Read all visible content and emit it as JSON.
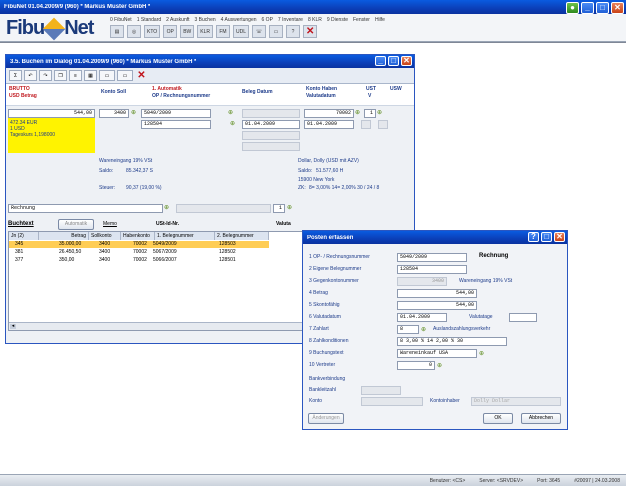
{
  "app": {
    "title": "FibuNet 01.04.2009/9 (960) * Markus Muster GmbH *",
    "logo_left": "Fibu",
    "logo_right": "Net",
    "menu": [
      "0 FibuNet",
      "1 Standard",
      "2 Auskunft",
      "3 Buchen",
      "4 Auswertungen",
      "6 OP",
      "7 Inventare",
      "8 KLR",
      "9 Dienste",
      "Fenster",
      "Hilfe"
    ],
    "toolbar": [
      "KTO",
      "OP",
      "BW",
      "KLR",
      "FM",
      "UDL"
    ],
    "status": [
      "Benutzer: <CS>",
      "Server: <SRVDEV>",
      "Port: 3645",
      "#20097 | 24.03.2008"
    ]
  },
  "rechnung": {
    "title": "3.5. Buchen im Dialog 01.04.2009/9 (960) * Markus Muster GmbH *",
    "headers": {
      "brutto": "BRUTTO",
      "betrag": "USD Betrag",
      "konto_soll": "Konto Soll",
      "automatik": "1. Automatik",
      "op_nr": "OP / Rechnungsnummer",
      "beleg_datum": "Beleg Datum",
      "konto_haben": "Konto Haben",
      "valutadatum": "Valutadatum",
      "ust": "UST",
      "v": "V",
      "usw": "USW"
    },
    "fields": {
      "betrag": "544,00",
      "konto_soll": "3400",
      "op_nr": "5049/2009",
      "beleg": "128504",
      "konto_haben": "70002",
      "ust": "1",
      "beleg_datum": "01.04.2009",
      "valutadatum": "01.04.2009"
    },
    "yellow": [
      "472.34 EUR",
      "1 USD",
      "Tageskurs 1,198000"
    ],
    "left_info": {
      "name": "Wareneingang 19% VSt",
      "saldo_label": "Saldo:",
      "saldo": "85.342,37 S",
      "steuer_label": "Steuer:",
      "steuer": "90,37 (19,00 %)"
    },
    "right_info": {
      "name": "Dollar, Dolly   (USD mit AZV)",
      "saldo_label": "Saldo:",
      "saldo": "51.577,60 H",
      "ort": "15900 New York",
      "zk_label": "ZK:",
      "zk": "8= 3,00%  14= 2,00%  30 / 24 / 8"
    },
    "text_field": "Rechnung",
    "text_field_num": "1",
    "table_tabs": [
      "Buchtext",
      "Automatik",
      "Memo",
      "USt-Id-Nr.",
      "Valuta"
    ],
    "table_headers": [
      "Jn (2)",
      "Betrag",
      "Sollkonto",
      "Habenkonto",
      "1. Belegnummer",
      "2. Belegnummer"
    ],
    "table_rows": [
      [
        "345",
        "35.000,00",
        "3400",
        "70002",
        "5049/2009",
        "128503"
      ],
      [
        "381",
        "26.450,50",
        "3400",
        "70002",
        "5067/2009",
        "128502"
      ],
      [
        "377",
        "350,00",
        "3400",
        "70002",
        "5066/2007",
        "128501"
      ]
    ]
  },
  "posten": {
    "title": "Posten erfassen",
    "rows": [
      {
        "n": "1  OP- / Rechnungsnummer",
        "v": "5049/2009",
        "extra": "Rechnung"
      },
      {
        "n": "2  Eigene Belegnummer",
        "v": "128504",
        "extra": ""
      },
      {
        "n": "3  Gegenkontonummer",
        "v": "3400",
        "extra": "Wareneingang 19% VSt"
      },
      {
        "n": "4  Betrag",
        "v": "544,00",
        "extra": ""
      },
      {
        "n": "5  Skontofähig",
        "v": "544,00",
        "extra": ""
      },
      {
        "n": "6  Valutadatum",
        "v": "01.04.2009",
        "extra": "Valutatage"
      },
      {
        "n": "7  Zahlart",
        "v": "8",
        "extra": "Auslandszahlungsverkehr"
      },
      {
        "n": "8  Zahlkonditionen",
        "v": "8  3,00 %  14  2,00 %  30",
        "extra": ""
      },
      {
        "n": "9  Buchungstext",
        "v": "Wareneinkauf USA",
        "extra": ""
      },
      {
        "n": "10  Vertreter",
        "v": "0",
        "extra": ""
      }
    ],
    "bank_header": "Bankverbindung",
    "bankleitzahl": "Bankleitzahl",
    "konto": "Konto",
    "kontoinhaber": "Kontoinhaber",
    "kontoinhaber_value": "Dolly Dollar",
    "btn_aenderungen": "Änderungen",
    "btn_ok": "OK",
    "btn_abbrechen": "Abbrechen"
  }
}
